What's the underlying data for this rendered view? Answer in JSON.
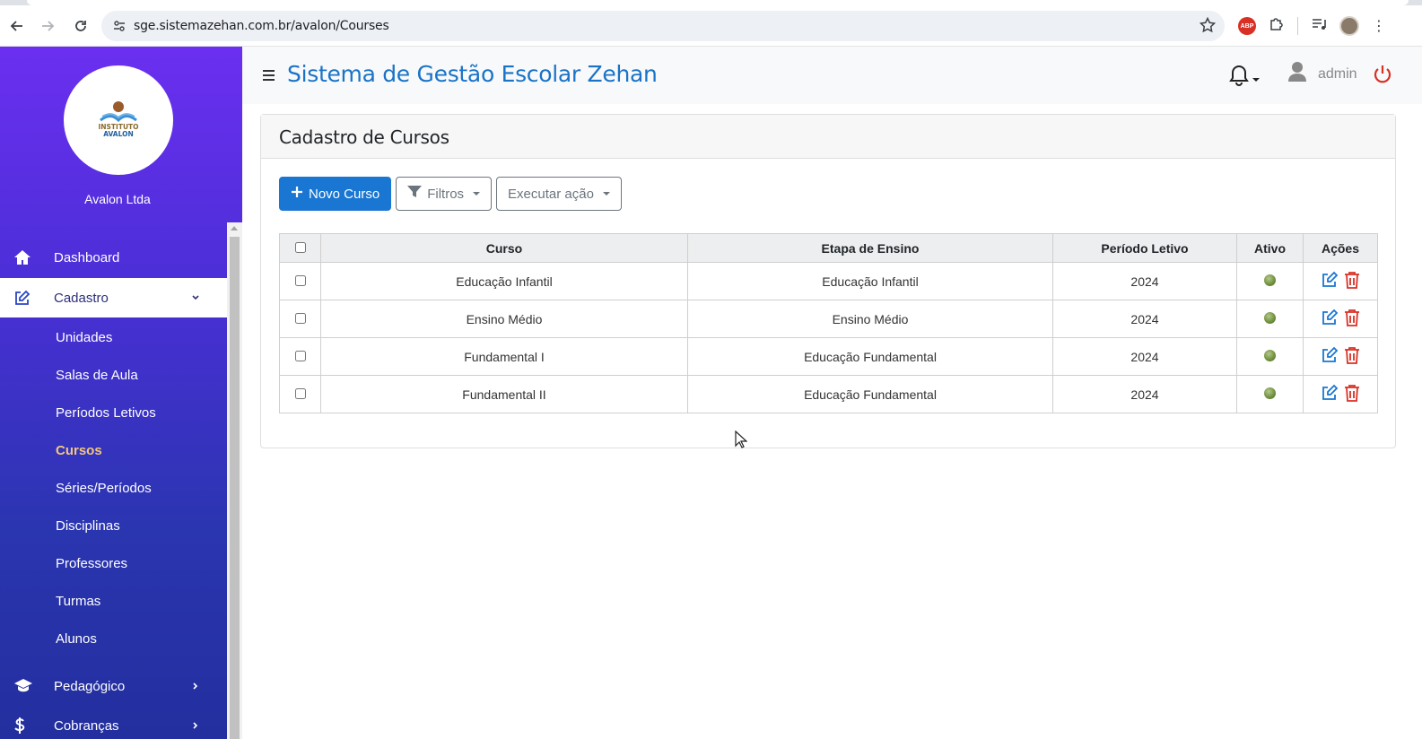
{
  "browser": {
    "url": "sge.sistemazehan.com.br/avalon/Courses"
  },
  "sidebar": {
    "logo_line1": "INSTITUTO",
    "logo_line2": "AVALON",
    "company": "Avalon Ltda",
    "items": [
      {
        "label": "Dashboard"
      },
      {
        "label": "Cadastro"
      },
      {
        "label": "Pedagógico"
      },
      {
        "label": "Cobranças"
      }
    ],
    "submenu": [
      {
        "label": "Unidades"
      },
      {
        "label": "Salas de Aula"
      },
      {
        "label": "Períodos Letivos"
      },
      {
        "label": "Cursos"
      },
      {
        "label": "Séries/Períodos"
      },
      {
        "label": "Disciplinas"
      },
      {
        "label": "Professores"
      },
      {
        "label": "Turmas"
      },
      {
        "label": "Alunos"
      }
    ]
  },
  "header": {
    "title": "Sistema de Gestão Escolar Zehan",
    "user": "admin"
  },
  "page": {
    "title": "Cadastro de Cursos",
    "new_button": "Novo Curso",
    "filters_button": "Filtros",
    "action_button": "Executar ação"
  },
  "table": {
    "columns": [
      "Curso",
      "Etapa de Ensino",
      "Período Letivo",
      "Ativo",
      "Ações"
    ],
    "rows": [
      {
        "curso": "Educação Infantil",
        "etapa": "Educação Infantil",
        "periodo": "2024"
      },
      {
        "curso": "Ensino Médio",
        "etapa": "Ensino Médio",
        "periodo": "2024"
      },
      {
        "curso": "Fundamental I",
        "etapa": "Educação Fundamental",
        "periodo": "2024"
      },
      {
        "curso": "Fundamental II",
        "etapa": "Educação Fundamental",
        "periodo": "2024"
      }
    ]
  },
  "colors": {
    "sidebar_top": "#6b2ff0",
    "sidebar_bottom": "#232f9e",
    "primary": "#1976d2",
    "title_blue": "#1a73c7",
    "active_menu": "#f3c77a",
    "danger": "#d93025"
  }
}
